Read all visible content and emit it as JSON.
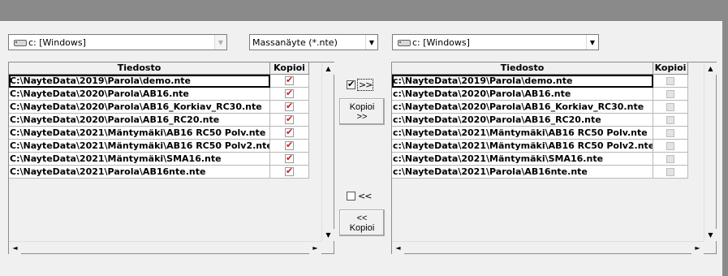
{
  "left_drive": {
    "value": "c: [Windows]",
    "icon": "drive-icon"
  },
  "filter": {
    "value": "Massanäyte (*.nte)"
  },
  "right_drive": {
    "value": "c: [Windows]",
    "icon": "drive-icon"
  },
  "left_grid": {
    "headers": {
      "file": "Tiedosto",
      "copy": "Kopioi"
    },
    "rows": [
      "C:\\NayteData\\2019\\Parola\\demo.nte",
      "C:\\NayteData\\2020\\Parola\\AB16.nte",
      "C:\\NayteData\\2020\\Parola\\AB16_Korkiav_RC30.nte",
      "C:\\NayteData\\2020\\Parola\\AB16_RC20.nte",
      "C:\\NayteData\\2021\\Mäntymäki\\AB16 RC50 Polv.nte",
      "C:\\NayteData\\2021\\Mäntymäki\\AB16 RC50 Polv2.nte",
      "C:\\NayteData\\2021\\Mäntymäki\\SMA16.nte",
      "C:\\NayteData\\2021\\Parola\\AB16nte.nte"
    ]
  },
  "right_grid": {
    "headers": {
      "file": "Tiedosto",
      "copy": "Kopioi"
    },
    "rows": [
      "c:\\NayteData\\2019\\Parola\\demo.nte",
      "c:\\NayteData\\2020\\Parola\\AB16.nte",
      "c:\\NayteData\\2020\\Parola\\AB16_Korkiav_RC30.nte",
      "c:\\NayteData\\2020\\Parola\\AB16_RC20.nte",
      "c:\\NayteData\\2021\\Mäntymäki\\AB16 RC50 Polv.nte",
      "c:\\NayteData\\2021\\Mäntymäki\\AB16 RC50 Polv2.nte",
      "c:\\NayteData\\2021\\Mäntymäki\\SMA16.nte",
      "c:\\NayteData\\2021\\Parola\\AB16nte.nte"
    ]
  },
  "middle": {
    "forward_check_label": ">>",
    "forward_checked": true,
    "copy_forward_label": "Kopioi >>",
    "back_check_label": "<<",
    "back_checked": false,
    "copy_back_label": "<< Kopioi"
  },
  "icons": {
    "scroll_up": "▲",
    "scroll_down": "▼",
    "scroll_left": "◄",
    "scroll_right": "►",
    "dropdown": "▼"
  }
}
